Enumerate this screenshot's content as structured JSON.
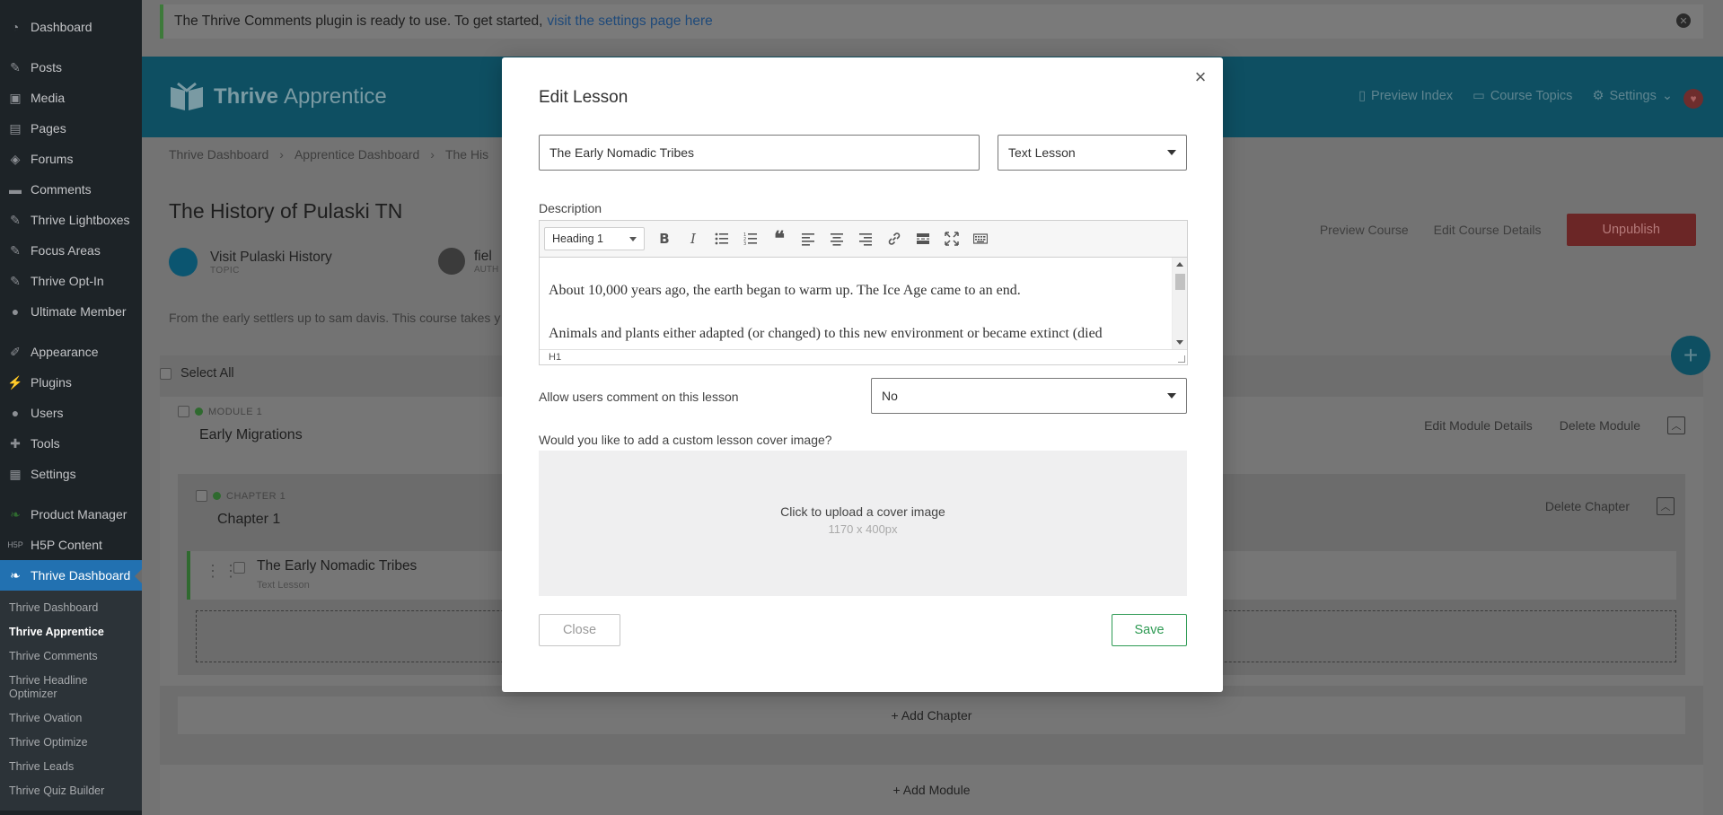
{
  "sidebar": {
    "items": [
      {
        "label": "Dashboard",
        "icon": "gauge-icon"
      },
      {
        "label": "Posts",
        "icon": "pin-icon"
      },
      {
        "label": "Media",
        "icon": "media-icon"
      },
      {
        "label": "Pages",
        "icon": "page-icon"
      },
      {
        "label": "Forums",
        "icon": "forum-icon"
      },
      {
        "label": "Comments",
        "icon": "comment-icon"
      },
      {
        "label": "Thrive Lightboxes",
        "icon": "pin-icon"
      },
      {
        "label": "Focus Areas",
        "icon": "pin-icon"
      },
      {
        "label": "Thrive Opt-In",
        "icon": "pin-icon"
      },
      {
        "label": "Ultimate Member",
        "icon": "user-icon"
      },
      {
        "label": "Appearance",
        "icon": "brush-icon"
      },
      {
        "label": "Plugins",
        "icon": "plug-icon"
      },
      {
        "label": "Users",
        "icon": "user-icon"
      },
      {
        "label": "Tools",
        "icon": "wrench-icon"
      },
      {
        "label": "Settings",
        "icon": "settings-icon"
      },
      {
        "label": "Product Manager",
        "icon": "leaf-icon"
      },
      {
        "label": "H5P Content",
        "icon": "h5p-icon"
      },
      {
        "label": "Thrive Dashboard",
        "icon": "leaf-icon"
      }
    ],
    "submenu": [
      "Thrive Dashboard",
      "Thrive Apprentice",
      "Thrive Comments",
      "Thrive Headline Optimizer",
      "Thrive Ovation",
      "Thrive Optimize",
      "Thrive Leads",
      "Thrive Quiz Builder"
    ]
  },
  "notice": {
    "text": "The Thrive Comments plugin is ready to use. To get started,",
    "link": "visit the settings page here"
  },
  "header": {
    "brand_bold": "Thrive",
    "brand_light": "Apprentice",
    "nav": [
      "Preview Index",
      "Course Topics",
      "Settings"
    ]
  },
  "breadcrumbs": [
    "Thrive Dashboard",
    "Apprentice Dashboard",
    "The His"
  ],
  "course": {
    "title": "The History of Pulaski TN",
    "topic": "Visit Pulaski History",
    "topic_label": "TOPIC",
    "author": "fiel",
    "author_label": "AUTH",
    "description": "From the early settlers up to sam davis. This course takes y",
    "actions": [
      "Preview Course",
      "Edit Course Details"
    ],
    "unpublish": "Unpublish"
  },
  "list": {
    "select_all": "Select All",
    "module_label": "MODULE 1",
    "module_name": "Early Migrations",
    "module_actions": [
      "Edit Module Details",
      "Delete Module"
    ],
    "chapter_label": "CHAPTER 1",
    "chapter_name": "Chapter 1",
    "chapter_action": "Delete Chapter",
    "lesson_name": "The Early Nomadic Tribes",
    "lesson_type": "Text Lesson",
    "add_chapter": "+ Add Chapter",
    "add_module": "+ Add Module"
  },
  "modal": {
    "title": "Edit Lesson",
    "lesson_title": "The Early Nomadic Tribes",
    "lesson_type": "Text Lesson",
    "description_label": "Description",
    "format": "Heading 1",
    "content_p1": "About 10,000 years ago, the earth began to warm up. The Ice Age came to an end.",
    "content_p2": "Animals and plants either adapted (or changed) to this new environment or became extinct (died",
    "status_path": "H1",
    "comments_label": "Allow users comment on this lesson",
    "comments_value": "No",
    "cover_label": "Would you like to add a custom lesson cover image?",
    "cover_upload": "Click to upload a cover image",
    "cover_size": "1170 x 400px",
    "close": "Close",
    "save": "Save"
  },
  "colors": {
    "save": "#2e9a53",
    "unpublish": "#c0392b",
    "brand": "#1a8fb0"
  }
}
